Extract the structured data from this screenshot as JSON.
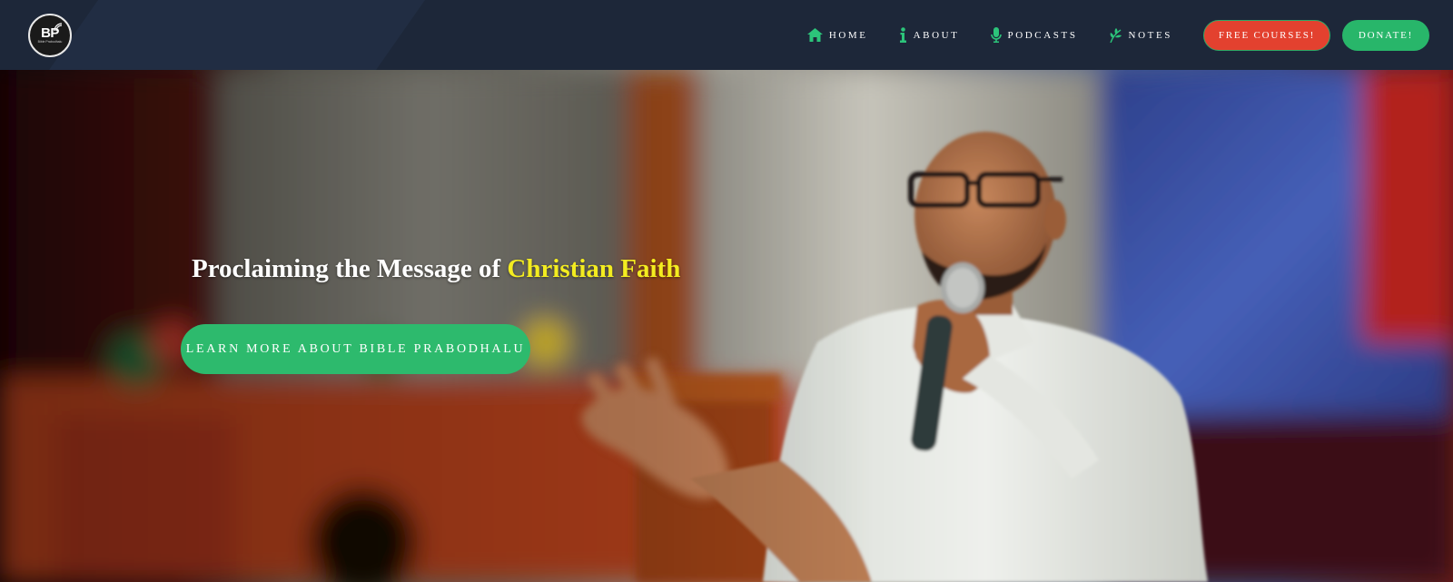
{
  "header": {
    "logo": {
      "mark": "BP",
      "subtitle": "Bible Prabodhalu"
    },
    "nav": [
      {
        "label": "HOME",
        "icon": "home-icon"
      },
      {
        "label": "ABOUT",
        "icon": "info-icon"
      },
      {
        "label": "PODCASTS",
        "icon": "microphone-icon"
      },
      {
        "label": "NOTES",
        "icon": "leaf-icon"
      }
    ],
    "buttons": {
      "free_courses": "FREE COURSES!",
      "donate": "DONATE!"
    }
  },
  "hero": {
    "headline_prefix": "Proclaiming the Message of ",
    "headline_highlight": "Christian Faith",
    "cta_label": "LEARN MORE ABOUT BIBLE PRABODHALU",
    "image": "speaker-with-microphone-photo"
  },
  "colors": {
    "header_bg": "#1d2739",
    "accent_green": "#28b66a",
    "accent_red": "#e3412f",
    "highlight_yellow": "#f3ec20"
  }
}
